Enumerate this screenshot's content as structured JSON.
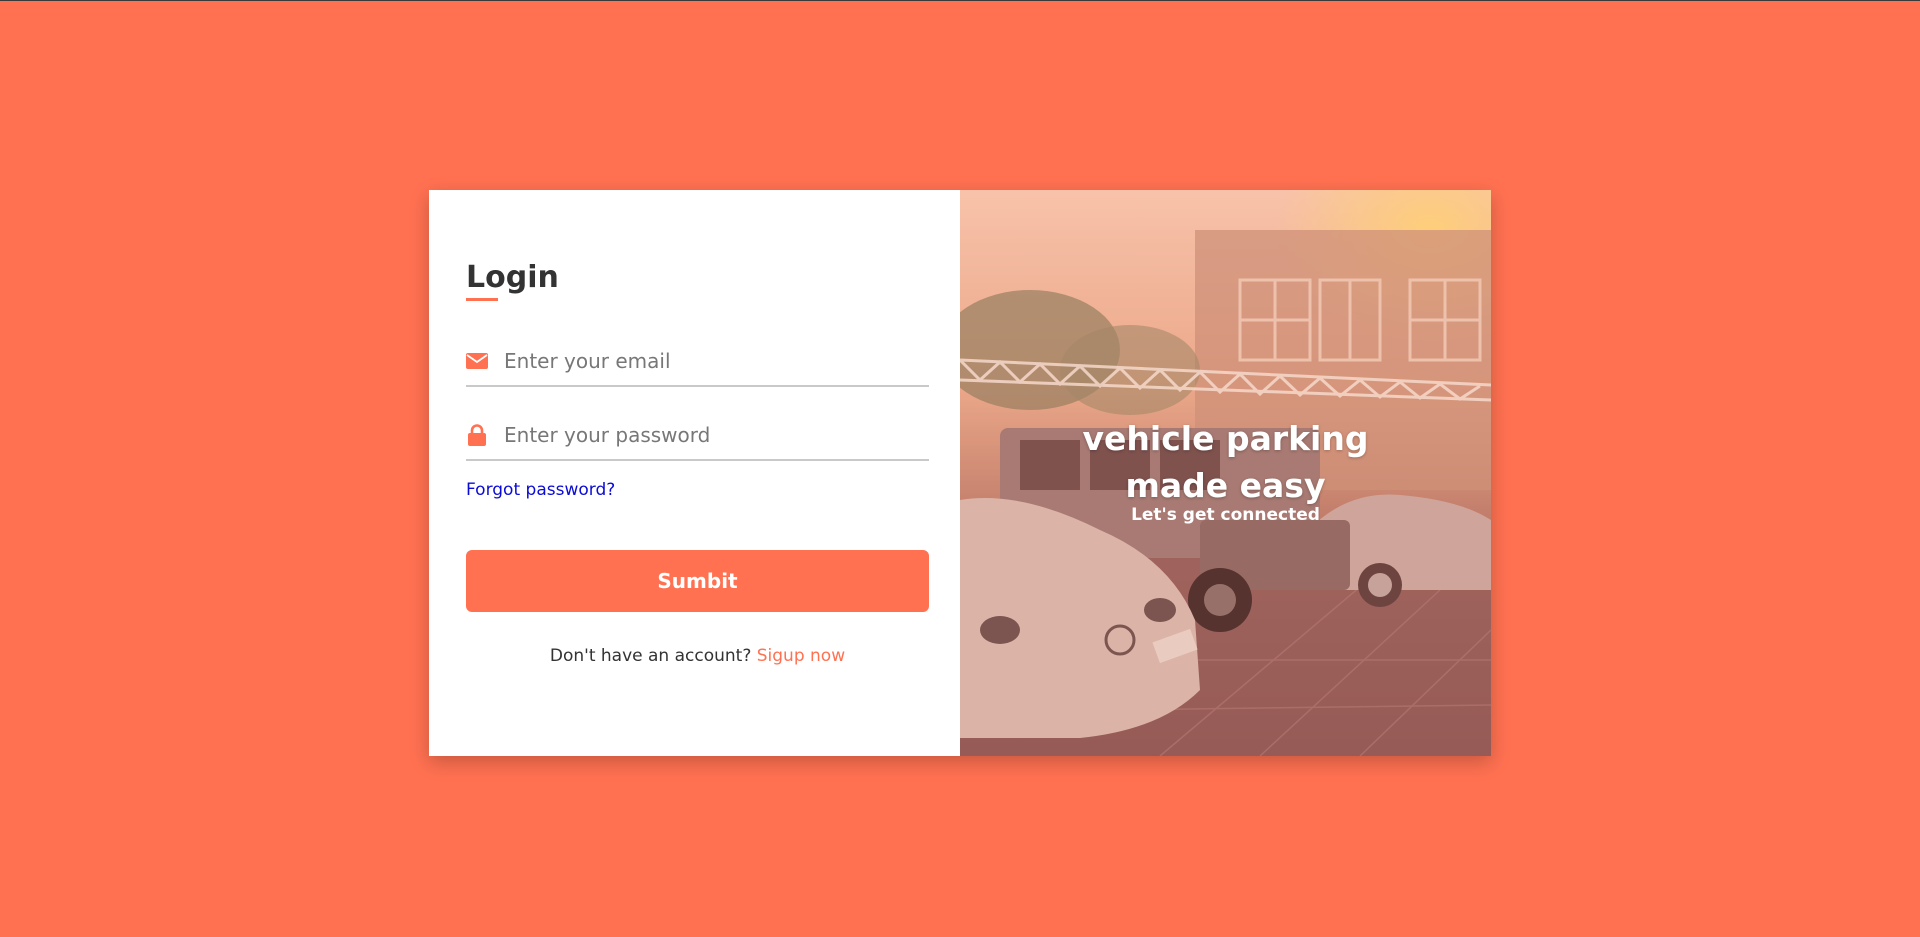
{
  "colors": {
    "accent": "#ff7151",
    "link": "#0b0bd6",
    "text": "#333333",
    "placeholder": "#777777"
  },
  "login": {
    "title": "Login",
    "email": {
      "icon": "envelope-icon",
      "placeholder": "Enter your email",
      "value": ""
    },
    "password": {
      "icon": "lock-icon",
      "placeholder": "Enter your password",
      "value": ""
    },
    "forgot_label": "Forgot password?",
    "submit_label": "Sumbit",
    "signup_prompt": "Don't have an account?",
    "signup_link": "Sigup now"
  },
  "hero": {
    "title": "vehicle parking made easy",
    "subtitle": "Let's get connected"
  }
}
